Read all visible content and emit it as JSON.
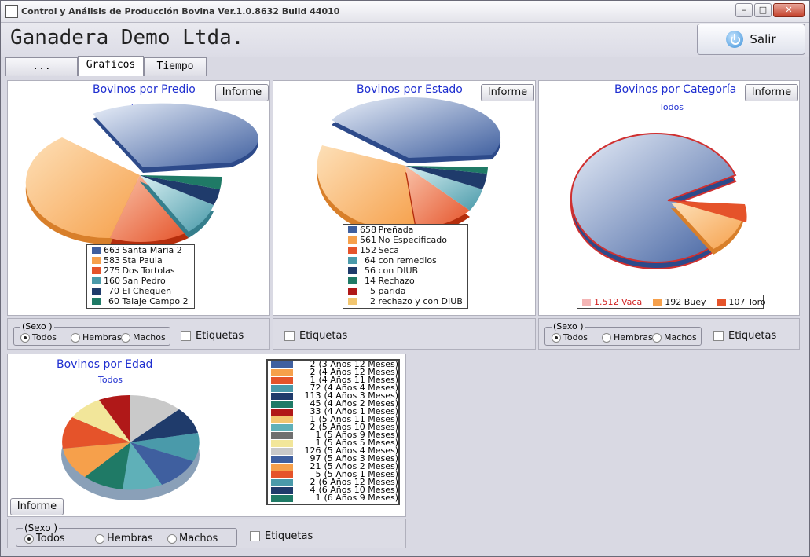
{
  "window": {
    "title": "Control y Análisis de Producción Bovina  Ver.1.0.8632 Build 44010",
    "min": "–",
    "max": "□",
    "close": "✕"
  },
  "header": {
    "company": "Ganadera Demo Ltda.",
    "salir": "Salir"
  },
  "tabs": [
    {
      "label": "..."
    },
    {
      "label": "Graficos"
    },
    {
      "label": "Tiempo"
    }
  ],
  "predio": {
    "title": "Bovinos por Predio",
    "subtitle": "Todos",
    "informe": "Informe",
    "legend": [
      {
        "value": "663",
        "label": "Santa Maria 2",
        "color": "#3f5f9f"
      },
      {
        "value": "583",
        "label": "Sta Paula",
        "color": "#f6a04b"
      },
      {
        "value": "275",
        "label": "Dos Tortolas",
        "color": "#e5532a"
      },
      {
        "value": "160",
        "label": "San Pedro",
        "color": "#4a9aaa"
      },
      {
        "value": "70",
        "label": "El Chequen",
        "color": "#1f3b6b"
      },
      {
        "value": "60",
        "label": "Talaje Campo 2",
        "color": "#1f7a66"
      }
    ]
  },
  "estado": {
    "title": "Bovinos por Estado",
    "informe": "Informe",
    "legend": [
      {
        "value": "658",
        "label": "Preñada",
        "color": "#3f5f9f"
      },
      {
        "value": "561",
        "label": "No Especificado",
        "color": "#f6a04b"
      },
      {
        "value": "152",
        "label": "Seca",
        "color": "#e5532a"
      },
      {
        "value": "64",
        "label": "con remedios",
        "color": "#4a9aaa"
      },
      {
        "value": "56",
        "label": "con DIUB",
        "color": "#1f3b6b"
      },
      {
        "value": "14",
        "label": "Rechazo",
        "color": "#1f7a66"
      },
      {
        "value": "5",
        "label": "parida",
        "color": "#b01818"
      },
      {
        "value": "2",
        "label": "rechazo y con DIUB",
        "color": "#f2c670"
      }
    ]
  },
  "categoria": {
    "title": "Bovinos por Categoría",
    "subtitle": "Todos",
    "informe": "Informe",
    "legend": [
      {
        "value": "1.512",
        "label": "Vaca",
        "color": "#e05050"
      },
      {
        "value": "192",
        "label": "Buey",
        "color": "#f6a04b"
      },
      {
        "value": "107",
        "label": "Toro",
        "color": "#e5532a"
      }
    ]
  },
  "edad": {
    "title": "Bovinos por Edad",
    "subtitle": "Todos",
    "informe": "Informe",
    "legend": [
      {
        "value": "2",
        "label": "(3 Años 12 Meses)",
        "color": "#3f5f9f"
      },
      {
        "value": "2",
        "label": "(4 Años 12 Meses)",
        "color": "#f6a04b"
      },
      {
        "value": "1",
        "label": "(4 Años 11 Meses)",
        "color": "#e5532a"
      },
      {
        "value": "72",
        "label": "(4 Años 4 Meses)",
        "color": "#4a9aaa"
      },
      {
        "value": "113",
        "label": "(4 Años 3 Meses)",
        "color": "#1f3b6b"
      },
      {
        "value": "45",
        "label": "(4 Años 2 Meses)",
        "color": "#1f7a66"
      },
      {
        "value": "33",
        "label": "(4 Años 1 Meses)",
        "color": "#b01818"
      },
      {
        "value": "1",
        "label": "(5 Años 11 Meses)",
        "color": "#f2c670"
      },
      {
        "value": "2",
        "label": "(5 Años 10 Meses)",
        "color": "#5fb0b8"
      },
      {
        "value": "1",
        "label": "(5 Años 9 Meses)",
        "color": "#6f6f6f"
      },
      {
        "value": "1",
        "label": "(5 Años 5 Meses)",
        "color": "#f2e69a"
      },
      {
        "value": "126",
        "label": "(5 Años 4 Meses)",
        "color": "#c9c9c9"
      },
      {
        "value": "97",
        "label": "(5 Años 3 Meses)",
        "color": "#3f5f9f"
      },
      {
        "value": "21",
        "label": "(5 Años 2 Meses)",
        "color": "#f6a04b"
      },
      {
        "value": "5",
        "label": "(5 Años 1 Meses)",
        "color": "#e5532a"
      },
      {
        "value": "2",
        "label": "(6 Años 12 Meses)",
        "color": "#4a9aaa"
      },
      {
        "value": "4",
        "label": "(6 Años 10 Meses)",
        "color": "#1f3b6b"
      },
      {
        "value": "1",
        "label": "(6 Años 9 Meses)",
        "color": "#1f7a66"
      }
    ]
  },
  "sexo": {
    "legend": "(Sexo )",
    "todos": "Todos",
    "hembras": "Hembras",
    "machos": "Machos",
    "selected": "Todos"
  },
  "etiquetas": "Etiquetas",
  "icons": {
    "app": "cow-icon",
    "salir": "power-icon"
  }
}
